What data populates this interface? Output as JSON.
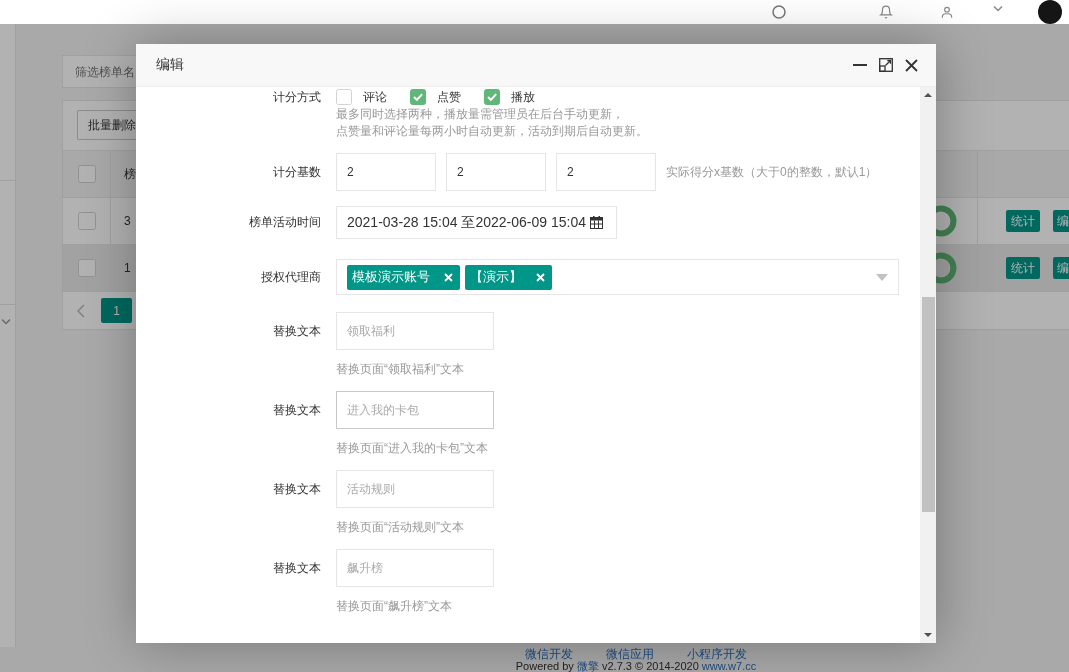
{
  "filter": {
    "placeholder": "筛选榜单名"
  },
  "table": {
    "toolbar": {
      "button": "批量删除"
    },
    "header": {
      "checked": false,
      "column_2": "榜"
    },
    "rows": [
      {
        "checked": false,
        "hovered": false,
        "column_2": "3",
        "actions": [
          "统计",
          "编"
        ]
      },
      {
        "checked": false,
        "hovered": true,
        "column_2": "1",
        "actions": [
          "统计",
          "编"
        ]
      }
    ],
    "pagination": {
      "pages": [
        {
          "label": "1",
          "selected": true
        }
      ]
    }
  },
  "modal": {
    "title": "编辑",
    "form": {
      "scoring": {
        "label": "计分方式",
        "options": [
          {
            "label": "评论",
            "checked": false
          },
          {
            "label": "点赞",
            "checked": true
          },
          {
            "label": "播放",
            "checked": true
          }
        ],
        "hint": [
          "最多同时选择两种，播放量需管理员在后台手动更新，",
          "点赞量和评论量每两小时自动更新，活动到期后自动更新。"
        ]
      },
      "base": {
        "label": "计分基数",
        "values": [
          "2",
          "2",
          "2"
        ],
        "hint": "实际得分x基数（大于0的整数，默认1）"
      },
      "period": {
        "label": "榜单活动时间",
        "value": "2021-03-28 15:04 至2022-06-09 15:04"
      },
      "agents": {
        "label": "授权代理商",
        "tags": [
          "模板演示账号",
          "【演示】"
        ]
      },
      "replace_texts": [
        {
          "label": "替换文本",
          "placeholder": "领取福利",
          "hint": "替换页面“领取福利”文本",
          "focused": false
        },
        {
          "label": "替换文本",
          "placeholder": "进入我的卡包",
          "hint": "替换页面“进入我的卡包”文本",
          "focused": true
        },
        {
          "label": "替换文本",
          "placeholder": "活动规则",
          "hint": "替换页面“活动规则”文本",
          "focused": false
        },
        {
          "label": "替换文本",
          "placeholder": "飙升榜",
          "hint": "替换页面“飙升榜”文本",
          "focused": false
        }
      ]
    }
  },
  "footer": {
    "links": [
      "微信开发",
      "微信应用",
      "小程序开发"
    ],
    "powered": {
      "prefix": "Powered by ",
      "brand": "微擎",
      "version": " v2.7.3 © 2014-2020 ",
      "site": "www.w7.cc"
    }
  }
}
